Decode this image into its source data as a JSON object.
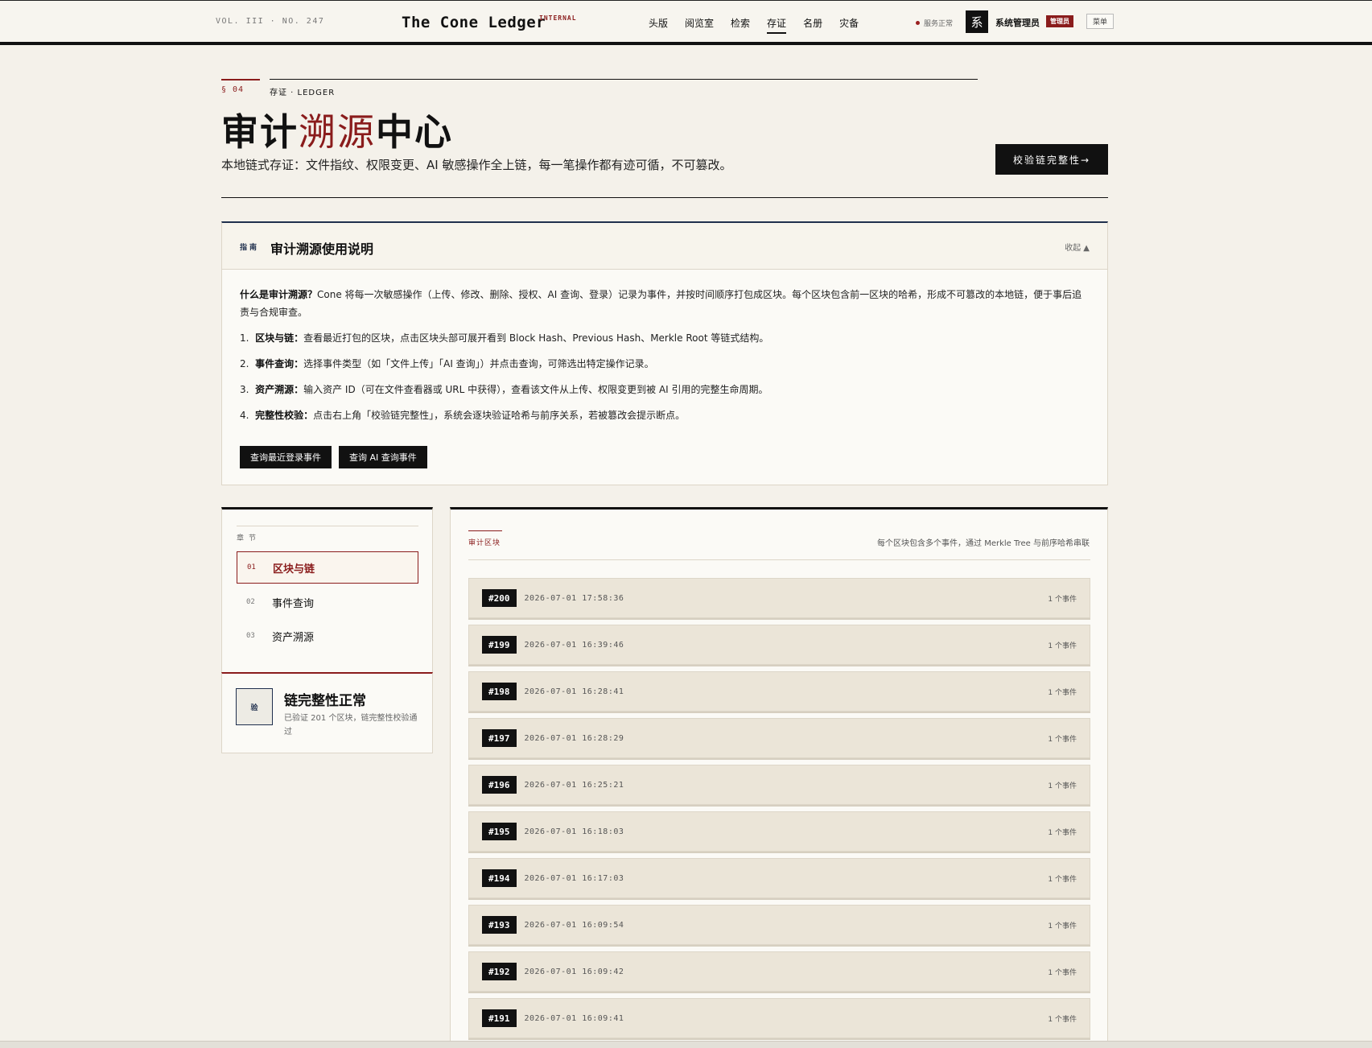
{
  "topbar": {
    "volume": "VOL. III · NO. 247",
    "brand": "The Cone Ledger",
    "brand_tag": "INTERNAL",
    "nav": [
      {
        "label": "头版"
      },
      {
        "label": "阅览室"
      },
      {
        "label": "检索"
      },
      {
        "label": "存证",
        "active": true
      },
      {
        "label": "名册"
      },
      {
        "label": "灾备"
      }
    ],
    "status": "服务正常",
    "avatar": "系",
    "user_name": "系统管理员",
    "user_role": "管理员",
    "menu": "菜单"
  },
  "header": {
    "section_num": "§ 04",
    "section_label": "存证 · LEDGER",
    "title_a": "审计",
    "title_accent": "溯源",
    "title_b": "中心",
    "subtitle": "本地链式存证：文件指纹、权限变更、AI 敏感操作全上链，每一笔操作都有迹可循，不可篡改。",
    "verify_button": "校验链完整性→"
  },
  "guide": {
    "badge": "指南",
    "title": "审计溯源使用说明",
    "collapse": "收起 ▲",
    "intro_bold": "什么是审计溯源？",
    "intro_text": "Cone 将每一次敏感操作（上传、修改、删除、授权、AI 查询、登录）记录为事件，并按时间顺序打包成区块。每个区块包含前一区块的哈希，形成不可篡改的本地链，便于事后追责与合规审查。",
    "steps": [
      {
        "num": "1.",
        "bold": "区块与链：",
        "text": "查看最近打包的区块，点击区块头部可展开看到 Block Hash、Previous Hash、Merkle Root 等链式结构。"
      },
      {
        "num": "2.",
        "bold": "事件查询：",
        "text": "选择事件类型（如「文件上传」「AI 查询」）并点击查询，可筛选出特定操作记录。"
      },
      {
        "num": "3.",
        "bold": "资产溯源：",
        "text": "输入资产 ID（可在文件查看器或 URL 中获得），查看该文件从上传、权限变更到被 AI 引用的完整生命周期。"
      },
      {
        "num": "4.",
        "bold": "完整性校验：",
        "text": "点击右上角「校验链完整性」，系统会逐块验证哈希与前序关系，若被篡改会提示断点。"
      }
    ],
    "actions": [
      "查询最近登录事件",
      "查询 AI 查询事件"
    ]
  },
  "toc": {
    "heading": "章节",
    "items": [
      {
        "num": "01",
        "label": "区块与链",
        "active": true
      },
      {
        "num": "02",
        "label": "事件查询"
      },
      {
        "num": "03",
        "label": "资产溯源"
      }
    ]
  },
  "integrity": {
    "icon_label": "验",
    "title": "链完整性正常",
    "desc": "已验证 201 个区块，链完整性校验通过"
  },
  "blocks": {
    "tab": "审计区块",
    "hint": "每个区块包含多个事件，通过 Merkle Tree 与前序哈希串联",
    "rows": [
      {
        "id": "#200",
        "ts": "2026-07-01 17:58:36",
        "count": "1 个事件"
      },
      {
        "id": "#199",
        "ts": "2026-07-01 16:39:46",
        "count": "1 个事件"
      },
      {
        "id": "#198",
        "ts": "2026-07-01 16:28:41",
        "count": "1 个事件"
      },
      {
        "id": "#197",
        "ts": "2026-07-01 16:28:29",
        "count": "1 个事件"
      },
      {
        "id": "#196",
        "ts": "2026-07-01 16:25:21",
        "count": "1 个事件"
      },
      {
        "id": "#195",
        "ts": "2026-07-01 16:18:03",
        "count": "1 个事件"
      },
      {
        "id": "#194",
        "ts": "2026-07-01 16:17:03",
        "count": "1 个事件"
      },
      {
        "id": "#193",
        "ts": "2026-07-01 16:09:54",
        "count": "1 个事件"
      },
      {
        "id": "#192",
        "ts": "2026-07-01 16:09:42",
        "count": "1 个事件"
      },
      {
        "id": "#191",
        "ts": "2026-07-01 16:09:41",
        "count": "1 个事件"
      }
    ]
  },
  "colors": {
    "accent": "#8a1c1c",
    "ink": "#111111",
    "navy": "#1f2f4d",
    "paper": "#f4f1ea"
  }
}
